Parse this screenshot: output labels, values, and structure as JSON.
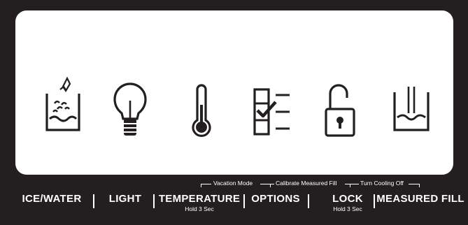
{
  "panel": {
    "icons": [
      "ice-water-icon",
      "light-bulb-icon",
      "thermometer-icon",
      "options-checklist-icon",
      "lock-icon",
      "measured-fill-icon"
    ]
  },
  "hints": {
    "vacation_mode": "Vacation Mode",
    "calibrate": "Calibrate Measured Fill",
    "cooling_off": "Turn Cooling Off"
  },
  "buttons": {
    "ice_water": {
      "label": "ICE/WATER"
    },
    "light": {
      "label": "LIGHT"
    },
    "temperature": {
      "label": "TEMPERATURE",
      "sub": "Hold 3 Sec"
    },
    "options": {
      "label": "OPTIONS"
    },
    "lock": {
      "label": "LOCK",
      "sub": "Hold 3 Sec"
    },
    "measured_fill": {
      "label": "MEASURED FILL"
    }
  }
}
